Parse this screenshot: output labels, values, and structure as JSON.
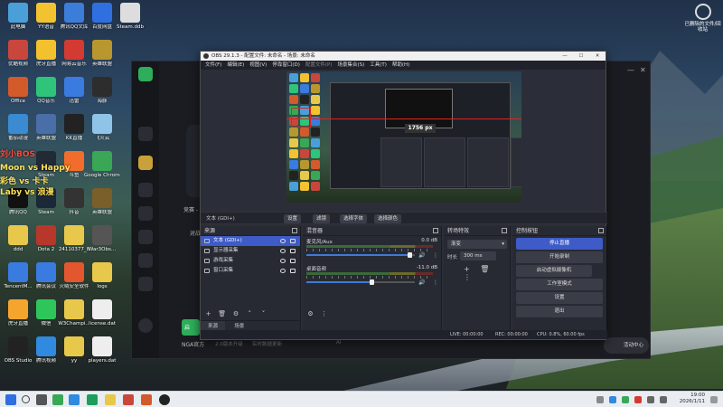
{
  "desktop": {
    "icons": [
      {
        "label": "此电脑",
        "color": "#4a9fd8",
        "col": 0,
        "row": 0
      },
      {
        "label": "YY语音",
        "color": "#f2c230",
        "col": 1,
        "row": 0
      },
      {
        "label": "腾讯QQ文库",
        "color": "#3b7dd8",
        "col": 2,
        "row": 0
      },
      {
        "label": "百度网盘",
        "color": "#2f6fe0",
        "col": 3,
        "row": 0
      },
      {
        "label": "Steam.ddb",
        "color": "#dddddd",
        "col": 4,
        "row": 0
      },
      {
        "label": "优酷视频",
        "color": "#c9463d",
        "col": 0,
        "row": 1
      },
      {
        "label": "虎牙直播",
        "color": "#f3c12e",
        "col": 1,
        "row": 1
      },
      {
        "label": "网易云音乐",
        "color": "#d33a31",
        "col": 2,
        "row": 1
      },
      {
        "label": "英雄联盟",
        "color": "#b8972e",
        "col": 3,
        "row": 1
      },
      {
        "label": "Office",
        "color": "#d35a2a",
        "col": 0,
        "row": 2
      },
      {
        "label": "QQ音乐",
        "color": "#2ec47a",
        "col": 1,
        "row": 2
      },
      {
        "label": "迅雷",
        "color": "#3a7be0",
        "col": 2,
        "row": 2
      },
      {
        "label": "海豚",
        "color": "#2d2d2d",
        "col": 3,
        "row": 2
      },
      {
        "label": "番茄动漫",
        "color": "#3a8bd1",
        "col": 0,
        "row": 3
      },
      {
        "label": "英雄联盟",
        "color": "#4a6ea8",
        "col": 1,
        "row": 3
      },
      {
        "label": "KK直播",
        "color": "#222222",
        "col": 2,
        "row": 3
      },
      {
        "label": "飞火云",
        "color": "#8fc4e8",
        "col": 3,
        "row": 3
      },
      {
        "label": "Steam",
        "color": "#222a36",
        "col": 1,
        "row": 4
      },
      {
        "label": "斗鱼",
        "color": "#f26d2b",
        "col": 2,
        "row": 4
      },
      {
        "label": "Google Chrome",
        "color": "#3aa757",
        "col": 3,
        "row": 4
      },
      {
        "label": "腾讯QQ",
        "color": "#111111",
        "col": 0,
        "row": 5
      },
      {
        "label": "Steam",
        "color": "#1b2838",
        "col": 1,
        "row": 5
      },
      {
        "label": "抖音",
        "color": "#333333",
        "col": 2,
        "row": 5
      },
      {
        "label": "英雄联盟",
        "color": "#7a5f2a",
        "col": 3,
        "row": 5
      },
      {
        "label": "ddd",
        "color": "#e8c84a",
        "col": 0,
        "row": 6
      },
      {
        "label": "Dota 2",
        "color": "#b7372b",
        "col": 1,
        "row": 6
      },
      {
        "label": "24110377_8",
        "color": "#e8c84a",
        "col": 2,
        "row": 6
      },
      {
        "label": "War3Obs...",
        "color": "#555555",
        "col": 3,
        "row": 6
      },
      {
        "label": "TencentM...",
        "color": "#3a7be0",
        "col": 0,
        "row": 7
      },
      {
        "label": "腾讯会议",
        "color": "#3a7be0",
        "col": 1,
        "row": 7
      },
      {
        "label": "火绒安全软件",
        "color": "#e2572e",
        "col": 2,
        "row": 7
      },
      {
        "label": "logs",
        "color": "#e8c84a",
        "col": 3,
        "row": 7
      },
      {
        "label": "虎牙直播",
        "color": "#f3a52e",
        "col": 0,
        "row": 8
      },
      {
        "label": "微信",
        "color": "#2ec65b",
        "col": 1,
        "row": 8
      },
      {
        "label": "W3Champi...",
        "color": "#e8c84a",
        "col": 2,
        "row": 8
      },
      {
        "label": "license.dat",
        "color": "#eeeeee",
        "col": 3,
        "row": 8
      },
      {
        "label": "OBS Studio",
        "color": "#222222",
        "col": 0,
        "row": 9
      },
      {
        "label": "腾讯视频",
        "color": "#2f8ae0",
        "col": 1,
        "row": 9
      },
      {
        "label": "yy",
        "color": "#e8c84a",
        "col": 2,
        "row": 9
      },
      {
        "label": "players.dat",
        "color": "#eeeeee",
        "col": 3,
        "row": 9
      }
    ],
    "recycle_label": "已删除的文件/回收站",
    "overlay_lines": [
      {
        "text": "Moon vs Happy",
        "color": "#ffe35a"
      },
      {
        "text": "彩色 vs 卡卡",
        "color": "#ffe35a"
      },
      {
        "text": "Laby vs 浪漫",
        "color": "#ffe35a"
      }
    ],
    "overlay_tag": "刘小BOS",
    "overlay_tag_color": "#ff4b3a"
  },
  "bg_app": {
    "side_items": [
      {
        "text": "竞赛 - 1"
      },
      {
        "text": "对战"
      },
      {
        "text": "启"
      },
      {
        "text": "NGA官方"
      }
    ],
    "footer": [
      "2.0版本升级",
      "实时数据更新",
      "AI"
    ],
    "activity_label": "活动中心"
  },
  "obs": {
    "title": "OBS 29.1.3 - 配置文件: 未命名 - 场景: 未命名",
    "menu": [
      {
        "label": "文件(F)",
        "dim": false
      },
      {
        "label": "编辑(E)",
        "dim": false
      },
      {
        "label": "视图(V)",
        "dim": false
      },
      {
        "label": "停靠窗口(D)",
        "dim": false
      },
      {
        "label": "配置文件(P)",
        "dim": true
      },
      {
        "label": "场景集合(S)",
        "dim": false
      },
      {
        "label": "工具(T)",
        "dim": false
      },
      {
        "label": "帮助(H)",
        "dim": false
      }
    ],
    "preview_badge": "1756 px",
    "source_bar": {
      "current": "文本 (GDI+)",
      "properties": "设置",
      "filters": "滤镜",
      "font": "选择字体",
      "color": "选择颜色"
    },
    "sources": {
      "title": "来源",
      "items": [
        {
          "label": "文本 (GDI+)",
          "selected": true
        },
        {
          "label": "显示器采集",
          "selected": false
        },
        {
          "label": "游戏采集",
          "selected": false
        },
        {
          "label": "窗口采集",
          "selected": false
        }
      ],
      "tabs": [
        "来源",
        "场景"
      ]
    },
    "mixer": {
      "title": "混音器",
      "channels": [
        {
          "name": "麦克风/Aux",
          "db": "0.0 dB",
          "volume": 0.95
        },
        {
          "name": "桌面音频",
          "db": "-11.0 dB",
          "volume": 0.6
        }
      ]
    },
    "transitions": {
      "title": "转场特效",
      "selected": "渐变",
      "duration_label": "时长",
      "duration": "300 ms"
    },
    "controls": {
      "title": "控制按钮",
      "buttons": [
        {
          "label": "停止直播",
          "primary": true
        },
        {
          "label": "开始录制",
          "primary": false
        },
        {
          "label": "启动虚拟摄像机",
          "primary": false
        },
        {
          "label": "工作室模式",
          "primary": false
        },
        {
          "label": "设置",
          "primary": false
        },
        {
          "label": "退出",
          "primary": false
        }
      ]
    },
    "status": {
      "live": "LIVE: 00:00:00",
      "rec": "REC: 00:00:00",
      "cpu": "CPU: 0.8%, 60.00 fps"
    }
  },
  "taskbar": {
    "time": "19:00",
    "date": "2026/1/11"
  }
}
